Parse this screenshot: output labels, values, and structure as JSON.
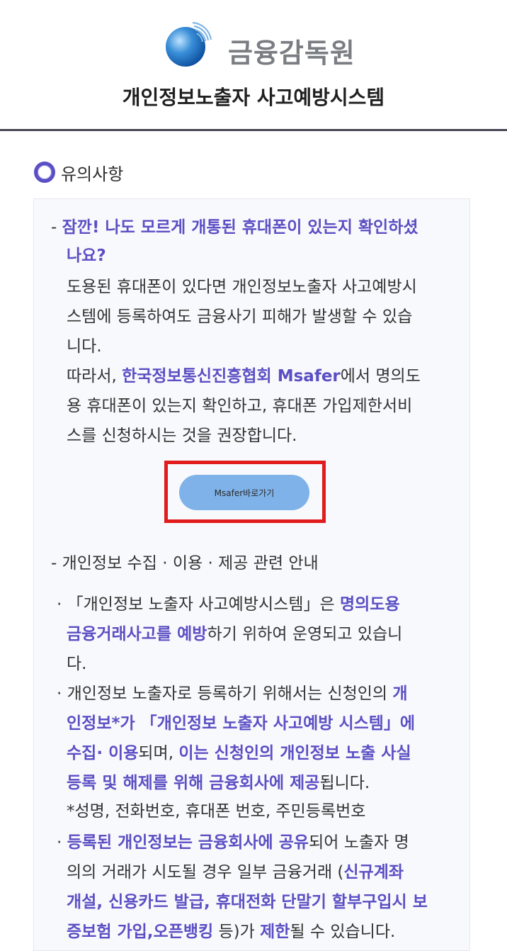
{
  "header": {
    "logo_text": "금융감독원",
    "title": "개인정보노출자 사고예방시스템"
  },
  "section": {
    "title": "유의사항"
  },
  "notice": {
    "block1": {
      "dash": "- ",
      "question_line1": "잠깐! 나도 모르게 개통된 휴대폰이 있는지 확인하셨",
      "question_line2": "나요?",
      "body_line1": "도용된 휴대폰이 있다면 개인정보노출자 사고예방시",
      "body_line2": "스템에 등록하여도 금융사기 피해가 발생할 수 있습",
      "body_line3": "니다.",
      "body_line4_a": "따라서, ",
      "body_line4_b": "한국정보통신진흥협회 Msafer",
      "body_line4_c": "에서 명의도",
      "body_line5": "용 휴대폰이 있는지 확인하고, 휴대폰 가입제한서비",
      "body_line6": "스를 신청하시는 것을 권장합니다."
    },
    "msafer_button": "Msafer바로가기",
    "block2": {
      "heading": "- 개인정보 수집 · 이용 · 제공 관련 안내",
      "item1_line1_a": "·  「개인정보 노출자 사고예방시스템」은 ",
      "item1_line1_b": "명의도용",
      "item1_line2_a": "금융거래사고를 예방",
      "item1_line2_b": "하기 위하여 운영되고 있습니",
      "item1_line3": "다.",
      "item2_line1_a": "·  개인정보 노출자로 등록하기 위해서는 신청인의 ",
      "item2_line1_b": "개",
      "item2_line2_a": "인정보*가 「개인정보 노출자 사고예방 시스템」에",
      "item2_line3_a": "수집· 이용",
      "item2_line3_b": "되며, ",
      "item2_line3_c": "이는 신청인의 개인정보 노출 사실",
      "item2_line4_a": "등록 및 해제를 위해 금융회사에 제공",
      "item2_line4_b": "됩니다.",
      "item2_note": "*성명, 전화번호, 휴대폰 번호, 주민등록번호",
      "item3_line1_a": "·  ",
      "item3_line1_b": "등록된 개인정보는 금융회사에 공유",
      "item3_line1_c": "되어 노출자 명",
      "item3_line2_a": "의의 거래가 시도될 경우 일부 금융거래 (",
      "item3_line2_b": "신규계좌",
      "item3_line3": "개설, 신용카드 발급, 휴대전화 단말기 할부구입시 보",
      "item3_line4_a": "증보험 가입,오픈뱅킹",
      "item3_line4_b": " 등)가 ",
      "item3_line4_c": "제한",
      "item3_line4_d": "될 수 있습니다."
    }
  },
  "colors": {
    "accent": "#5b4fc4",
    "button": "#7eb2e8",
    "highlight_box": "#e11c1c",
    "header_rule": "#4a4654"
  }
}
